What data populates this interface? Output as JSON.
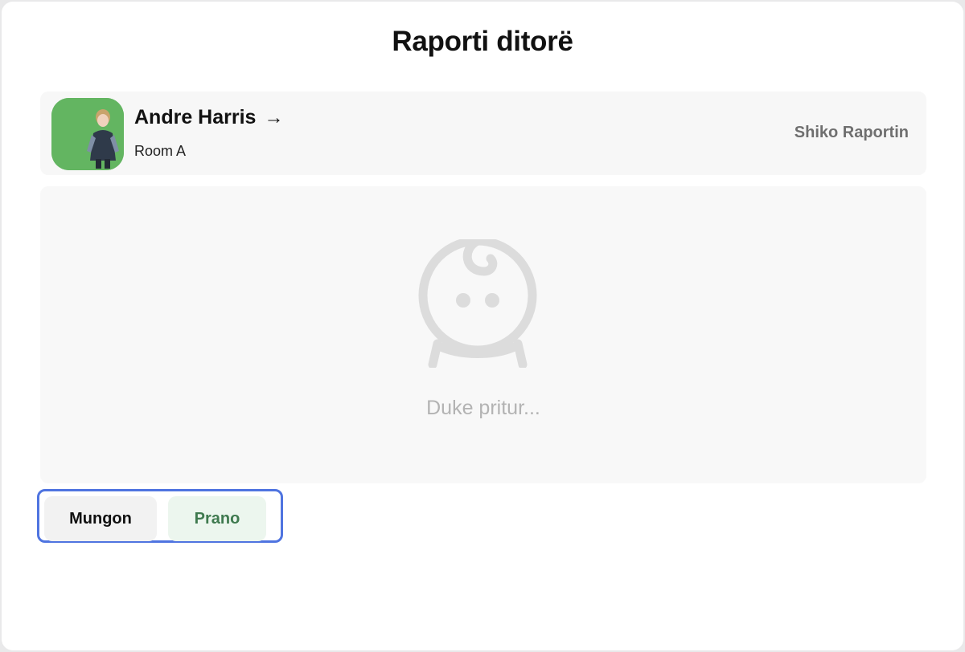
{
  "modal": {
    "title": "Raporti ditorë"
  },
  "child": {
    "name": "Andre Harris",
    "arrow": "→",
    "room": "Room A",
    "view_report_label": "Shiko Raportin"
  },
  "status": {
    "waiting_text": "Duke pritur...",
    "icon": "baby-face-icon"
  },
  "actions": {
    "absent_label": "Mungon",
    "accept_label": "Prano"
  },
  "colors": {
    "accent_outline": "#4f74e0",
    "accept_text": "#3f7a4f",
    "accept_bg": "#ecf6ee"
  }
}
